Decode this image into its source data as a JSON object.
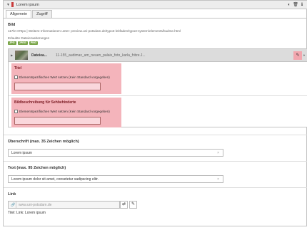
{
  "panel": {
    "title": "Lorem ipsum"
  },
  "tabs": [
    {
      "label": "Allgemein",
      "active": true
    },
    {
      "label": "Zugriff",
      "active": false
    }
  ],
  "bild": {
    "label": "Bild",
    "size_info": "117b×470px | Weitere Informationen unter: preview.uni-potsdam.de/typo3-leitfaden/typo3-system/elements/budme.html",
    "ext_label": "Erlaubte Dateierweiterungen",
    "extensions": [
      "JPG",
      "JPEG",
      "PNG"
    ]
  },
  "file": {
    "label": "Dateiea...",
    "name": "11-155_audimax_am_neuen_palais_foto_karla_fritze.J..."
  },
  "titel": {
    "label": "Titel",
    "checkbox_label": "Elementspezifischen Wert setzen (Kein Standard vorgegeben)"
  },
  "bildbeschreibung": {
    "label": "Bildbeschreibung für Sehbehinderte",
    "checkbox_label": "Elementspezifischen Wert setzen (Kein Standard vorgegeben)"
  },
  "ueberschrift": {
    "label": "Überschrift (max. 35 Zeichen möglich)",
    "value": "Lorem ipsum"
  },
  "text": {
    "label": "Text (max. 95 Zeichen möglich)",
    "value": "Lorem ipsum dolor sit amet, consetetur sadipscing elitr."
  },
  "link": {
    "label": "Link",
    "placeholder": "www.uni-potsdam.de",
    "info": "Titel: Link: Lorem ipsum"
  },
  "colors": {
    "highlight_pink": "#f4b4bb",
    "badge_green": "#79a548",
    "header_gray": "#ededed"
  },
  "icons": {
    "header": [
      "toggle-icon",
      "trash-icon",
      "info-icon"
    ],
    "file": [
      "pencil-icon",
      "eye-icon"
    ],
    "link": [
      "link-icon",
      "link-browser-icon",
      "link-edit-icon"
    ]
  }
}
